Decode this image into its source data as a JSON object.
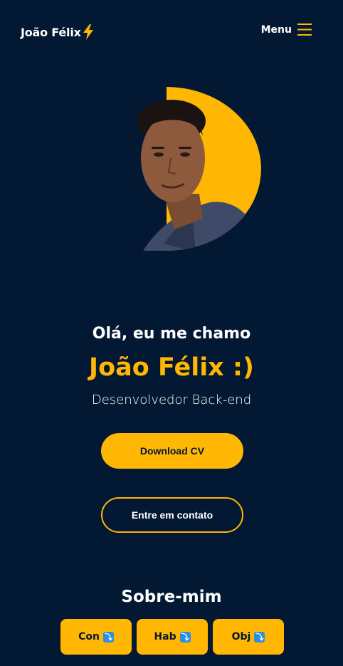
{
  "header": {
    "logo_text": "João Félix",
    "menu_label": "Menu"
  },
  "hero": {
    "greeting": "Olá, eu me chamo",
    "name": "João Félix :)",
    "role": "Desenvolvedor Back-end",
    "download_label": "Download CV",
    "contact_label": "Entre em contato"
  },
  "about": {
    "title": "Sobre-mim",
    "tabs": [
      {
        "label": "Con",
        "icon": "arrow-down-right-icon"
      },
      {
        "label": "Hab",
        "icon": "arrow-down-right-icon"
      },
      {
        "label": "Obj",
        "icon": "arrow-down-right-icon"
      }
    ]
  },
  "colors": {
    "background": "#031833",
    "accent": "#ffb703",
    "text": "#ffffff",
    "icon_blue": "#2d8ee6"
  }
}
